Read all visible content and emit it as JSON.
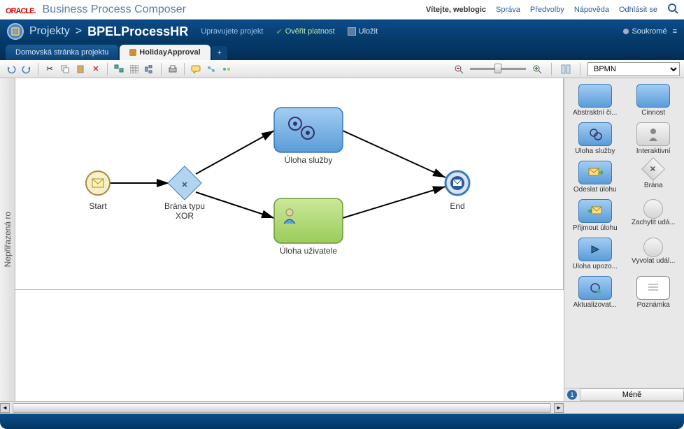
{
  "header": {
    "logo_text": "ORACLE",
    "app_title": "Business Process Composer",
    "welcome": "Vítejte, weblogic",
    "links": [
      "Správa",
      "Předvolby",
      "Nápověda",
      "Odhlásit se"
    ]
  },
  "project_bar": {
    "crumb": "Projekty",
    "name": "BPELProcessHR",
    "editing": "Upravujete projekt",
    "validate": "Ověřit platnost",
    "save": "Uložit",
    "privacy": "Soukromé"
  },
  "tabs": {
    "items": [
      {
        "label": "Domovská stránka projektu",
        "active": false
      },
      {
        "label": "HolidayApproval",
        "active": true
      }
    ]
  },
  "toolbar": {
    "icons": [
      "undo",
      "redo",
      "cut",
      "copy",
      "paste",
      "delete",
      "align",
      "grid",
      "layout",
      "print",
      "comment",
      "link",
      "refresh"
    ],
    "zoom_out": "zoom-out",
    "zoom_in": "zoom-in",
    "layout_toggle": "layout",
    "palette_mode": "BPMN"
  },
  "side_panel_label": "Nepřiřazená ro",
  "diagram": {
    "nodes": {
      "start": "Start",
      "gateway": "Brána typu XOR",
      "service": "Úloha služby",
      "user": "Úloha uživatele",
      "end": "End"
    }
  },
  "palette": {
    "items": [
      {
        "label": "Abstraktní či...",
        "style": "blue",
        "icon": ""
      },
      {
        "label": "Činnost",
        "style": "blue",
        "icon": ""
      },
      {
        "label": "Úloha služby",
        "style": "blue",
        "icon": "gear"
      },
      {
        "label": "Interaktivní",
        "style": "gray",
        "icon": "user"
      },
      {
        "label": "Odeslat úlohu",
        "style": "blue",
        "icon": "mail-out"
      },
      {
        "label": "Brána",
        "style": "diamond",
        "icon": "x"
      },
      {
        "label": "Přijmout úlohu",
        "style": "blue",
        "icon": "mail-in"
      },
      {
        "label": "Zachytit udá...",
        "style": "circle",
        "icon": ""
      },
      {
        "label": "Úloha upozo...",
        "style": "blue",
        "icon": "play"
      },
      {
        "label": "Vyvolat udál...",
        "style": "circle",
        "icon": ""
      },
      {
        "label": "Aktualizovat...",
        "style": "blue",
        "icon": "gear"
      },
      {
        "label": "Poznámka",
        "style": "note",
        "icon": ""
      }
    ],
    "less": "Méně",
    "page": "1"
  }
}
